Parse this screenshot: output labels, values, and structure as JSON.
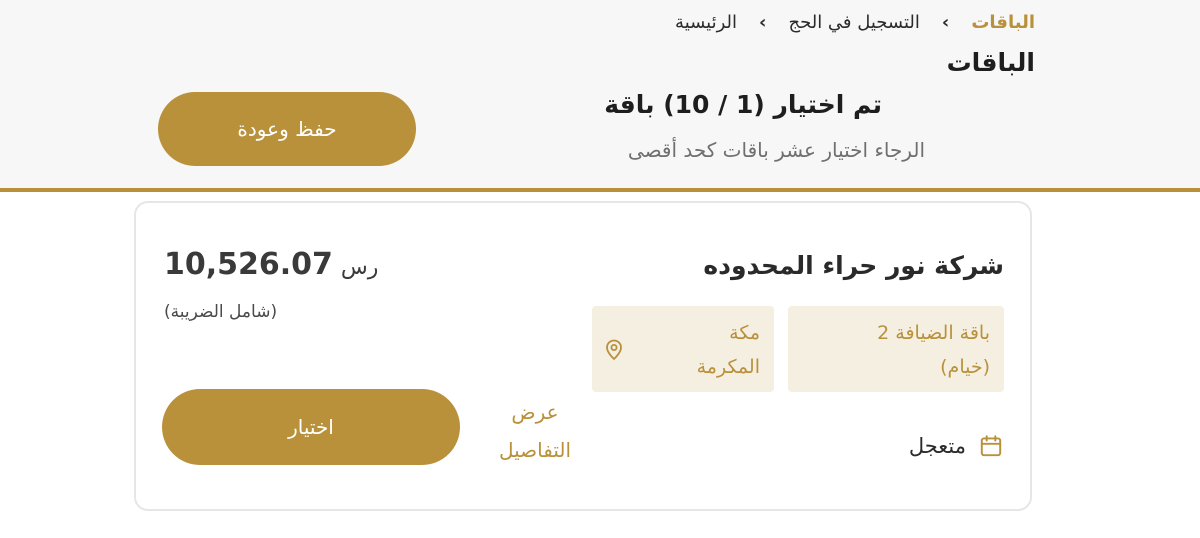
{
  "breadcrumb": {
    "home": "الرئيسية",
    "hajj_registration": "التسجيل في الحج",
    "packages": "الباقات"
  },
  "header": {
    "title": "الباقات",
    "selection_title": "تم اختيار (1 / 10) باقة",
    "selection_hint": "الرجاء اختيار عشر باقات كحد أقصى",
    "save_button_label": "حفظ وعودة"
  },
  "package_card": {
    "company_name": "شركة نور حراء المحدوده",
    "package_line1": "باقة الضيافة 2",
    "package_line2": "(خيام)",
    "location_line1": "مكة",
    "location_line2": "المكرمة",
    "schedule": "متعجل",
    "details_line1": "عرض",
    "details_line2": "التفاصيل",
    "price": "10,526.07",
    "currency": "رس",
    "tax_note": "(شامل الضريبة)",
    "select_button_label": "اختيار"
  },
  "colors": {
    "accent": "#b8913a",
    "chip_bg": "#f5efe2",
    "header_bg": "#f7f7f7"
  },
  "icons": {
    "breadcrumb_separator": "chevron-right-icon",
    "location": "map-pin-icon",
    "schedule": "calendar-icon"
  }
}
